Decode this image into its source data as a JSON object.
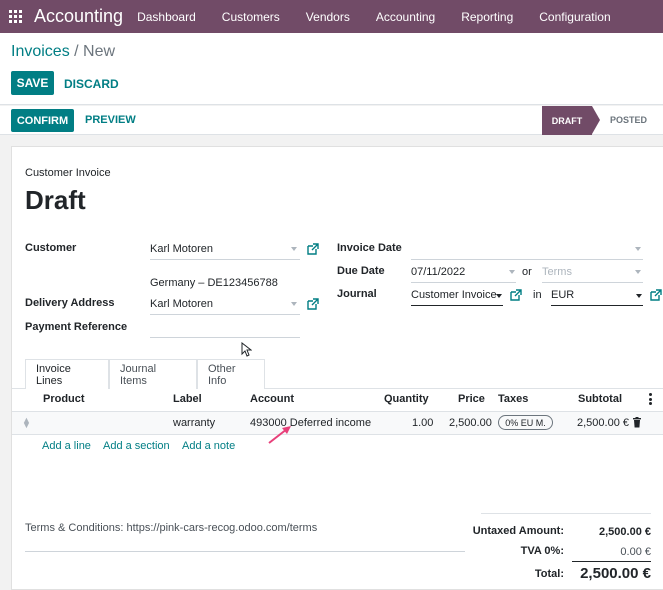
{
  "app": {
    "brand": "Accounting",
    "menu": [
      "Dashboard",
      "Customers",
      "Vendors",
      "Accounting",
      "Reporting",
      "Configuration"
    ]
  },
  "control": {
    "breadcrumb_parent": "Invoices",
    "breadcrumb_sep": " / ",
    "breadcrumb_current": "New",
    "save_label": "SAVE",
    "discard_label": "DISCARD"
  },
  "status": {
    "confirm_label": "CONFIRM",
    "preview_label": "PREVIEW",
    "stages": [
      "DRAFT",
      "POSTED"
    ],
    "active_stage": "DRAFT"
  },
  "form": {
    "type_label": "Customer Invoice",
    "title": "Draft",
    "customer_label": "Customer",
    "customer_value": "Karl Motoren",
    "customer_address": "Germany – DE123456788",
    "delivery_label": "Delivery Address",
    "delivery_value": "Karl Motoren",
    "payment_ref_label": "Payment Reference",
    "payment_ref_value": "",
    "invoice_date_label": "Invoice Date",
    "invoice_date_value": "",
    "due_date_label": "Due Date",
    "due_date_value": "07/11/2022",
    "or_label": "or",
    "terms_placeholder": "Terms",
    "journal_label": "Journal",
    "journal_value": "Customer Invoice",
    "in_label": "in",
    "currency_value": "EUR"
  },
  "tabs": [
    "Invoice Lines",
    "Journal Items",
    "Other Info"
  ],
  "table": {
    "headers": {
      "product": "Product",
      "label": "Label",
      "account": "Account",
      "quantity": "Quantity",
      "price": "Price",
      "taxes": "Taxes",
      "subtotal": "Subtotal"
    },
    "rows": [
      {
        "product": "",
        "label": "warranty",
        "account": "493000 Deferred income",
        "quantity": "1.00",
        "price": "2,500.00",
        "tax_badge": "0% EU M.",
        "subtotal": "2,500.00 €"
      }
    ],
    "add_line": "Add a line",
    "add_section": "Add a section",
    "add_note": "Add a note"
  },
  "footer": {
    "terms": "Terms & Conditions: https://pink-cars-recog.odoo.com/terms",
    "untaxed_label": "Untaxed Amount:",
    "untaxed_value": "2,500.00 €",
    "tva_label": "TVA 0%:",
    "tva_value": "0.00 €",
    "total_label": "Total:",
    "total_value": "2,500.00 €"
  },
  "colors": {
    "brand": "#714B67",
    "accent": "#017e84",
    "annotation_arrow": "#e8407a"
  },
  "icons": [
    "apps-grid-icon",
    "external-link-icon",
    "drag-handle-icon",
    "trash-icon",
    "kebab-menu-icon",
    "mouse-cursor-icon",
    "annotation-arrow-icon"
  ]
}
